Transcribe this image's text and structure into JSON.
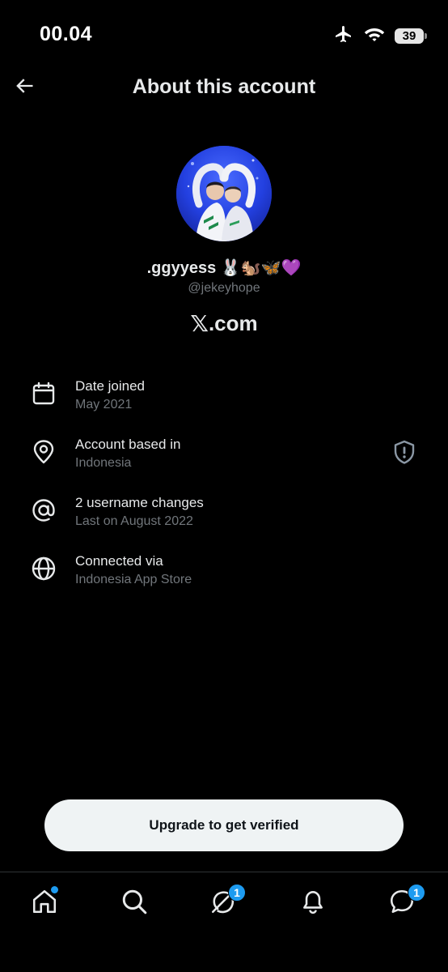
{
  "status_bar": {
    "time": "00.04",
    "battery_level": "39"
  },
  "header": {
    "title": "About this account"
  },
  "profile": {
    "display_name": ".ggyyess 🐰🐿️🦋💜",
    "handle": "@jekeyhope",
    "platform_mark": "𝕏",
    "platform_suffix": ".com"
  },
  "info_rows": [
    {
      "icon": "calendar-icon",
      "title": "Date joined",
      "subtitle": "May 2021"
    },
    {
      "icon": "location-pin-icon",
      "title": "Account based in",
      "subtitle": "Indonesia"
    },
    {
      "icon": "at-sign-icon",
      "title": "2 username changes",
      "subtitle": "Last on August 2022"
    },
    {
      "icon": "globe-icon",
      "title": "Connected via",
      "subtitle": "Indonesia App Store"
    }
  ],
  "upgrade_button": {
    "label": "Upgrade to get verified"
  },
  "bottom_nav": {
    "items": [
      {
        "icon": "home-icon",
        "has_dot": true
      },
      {
        "icon": "search-icon"
      },
      {
        "icon": "grok-icon",
        "badge": "1"
      },
      {
        "icon": "bell-icon"
      },
      {
        "icon": "messages-icon",
        "badge": "1"
      }
    ]
  },
  "colors": {
    "background": "#000000",
    "primary_text": "#e7e9ea",
    "secondary_text": "#71767b",
    "accent": "#1d9bf0",
    "button_bg": "#eff3f4"
  }
}
